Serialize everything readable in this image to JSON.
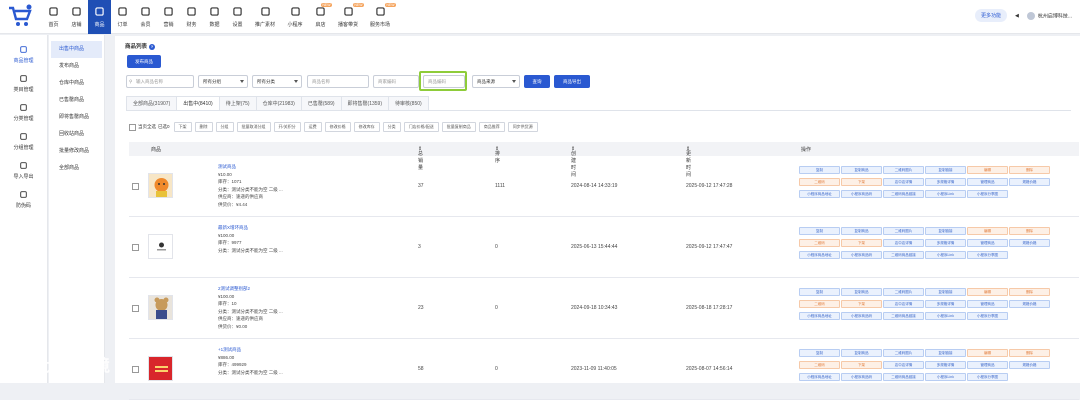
{
  "topnav": {
    "items": [
      {
        "label": "首页",
        "icon": "home-icon",
        "active": false,
        "badge": ""
      },
      {
        "label": "店铺",
        "icon": "shop-icon",
        "active": false,
        "badge": ""
      },
      {
        "label": "商品",
        "icon": "goods-icon",
        "active": true,
        "badge": ""
      },
      {
        "label": "订单",
        "icon": "order-icon",
        "active": false,
        "badge": ""
      },
      {
        "label": "会员",
        "icon": "member-icon",
        "active": false,
        "badge": ""
      },
      {
        "label": "营销",
        "icon": "marketing-icon",
        "active": false,
        "badge": ""
      },
      {
        "label": "财务",
        "icon": "finance-icon",
        "active": false,
        "badge": ""
      },
      {
        "label": "数据",
        "icon": "data-icon",
        "active": false,
        "badge": ""
      },
      {
        "label": "设置",
        "icon": "settings-icon",
        "active": false,
        "badge": ""
      },
      {
        "label": "推广素材",
        "icon": "share-icon",
        "active": false,
        "badge": ""
      },
      {
        "label": "小程序",
        "icon": "miniprogram-icon",
        "active": false,
        "badge": ""
      },
      {
        "label": "启店",
        "icon": "store-open-icon",
        "active": false,
        "badge": "NEW"
      },
      {
        "label": "播客带货",
        "icon": "live-icon",
        "active": false,
        "badge": "NEW"
      },
      {
        "label": "服务市场",
        "icon": "market-icon",
        "active": false,
        "badge": "NEW"
      }
    ],
    "more_features": "更多功能",
    "user": "杭州启博科技..."
  },
  "left_sidebar": [
    {
      "label": "商品管理",
      "icon": "goods-manage-icon",
      "active": true
    },
    {
      "label": "类目管理",
      "icon": "category-icon",
      "active": false
    },
    {
      "label": "分类管理",
      "icon": "classify-icon",
      "active": false
    },
    {
      "label": "分组管理",
      "icon": "group-icon",
      "active": false
    },
    {
      "label": "导入导出",
      "icon": "import-export-icon",
      "active": false
    },
    {
      "label": "防伪码",
      "icon": "anticounterfeit-icon",
      "active": false
    }
  ],
  "sub_sidebar": [
    {
      "label": "出售中商品",
      "active": true
    },
    {
      "label": "发布商品",
      "active": false
    },
    {
      "label": "仓库中商品",
      "active": false
    },
    {
      "label": "已售罄商品",
      "active": false
    },
    {
      "label": "即将售罄商品",
      "active": false
    },
    {
      "label": "回收站商品",
      "active": false
    },
    {
      "label": "批量修改商品",
      "active": false
    },
    {
      "label": "全部商品",
      "active": false
    }
  ],
  "page": {
    "title": "商品列表",
    "publish_button": "发布商品"
  },
  "filters": {
    "goods_name_placeholder": "输入商品名称",
    "group_select": "所有分组",
    "category_select": "所有分类",
    "name_placeholder": "商品名称",
    "merchant_code_placeholder": "商家编码",
    "goods_code_placeholder": "商品编码",
    "source_select": "商品来源",
    "search_button": "查询",
    "export_button": "商品导出"
  },
  "tabs": [
    {
      "label": "全部商品(31907)",
      "active": false
    },
    {
      "label": "出售中(8410)",
      "active": true
    },
    {
      "label": "待上架(75)",
      "active": false
    },
    {
      "label": "仓库中(21983)",
      "active": false
    },
    {
      "label": "已售罄(589)",
      "active": false
    },
    {
      "label": "即将售罄(1359)",
      "active": false
    },
    {
      "label": "待审核(850)",
      "active": false
    }
  ],
  "batch_actions": {
    "select_page": "当页全选",
    "selected": "已选0",
    "buttons": [
      "下架",
      "删除",
      "分组",
      "批量取消分组",
      "开/关积分",
      "运费",
      "修改价格",
      "修改库存",
      "分类",
      "门店价格/配送",
      "批量复制商品",
      "商品推荐",
      "同步供货源"
    ]
  },
  "table": {
    "headers": {
      "goods": "商品",
      "total_sales": "总销量",
      "sort": "排序",
      "created": "创建时间",
      "updated": "更新时间",
      "ops": "操作"
    },
    "rows": [
      {
        "name": "测试商品",
        "price": "¥10.00",
        "stock": "库存：1071",
        "category": "分类：测试分类不能为空 二级 ...",
        "supplier": "供应商：速递的供应商",
        "supply_price": "供货价：¥4.44",
        "total_sales": "37",
        "sort": "1111",
        "created": "2024-08-14 14:33:19",
        "updated": "2025-09-12 17:47:28",
        "thumb": "doll"
      },
      {
        "name": "最新X增环商品",
        "price": "¥100.00",
        "stock": "库存：9977",
        "category": "分类：测试分类不能为空 二级 ...",
        "supplier": "",
        "supply_price": "",
        "total_sales": "3",
        "sort": "0",
        "created": "2025-06-13 15:44:44",
        "updated": "2025-09-12 17:47:47",
        "thumb": "icon"
      },
      {
        "name": "2测试调整别部2",
        "price": "¥100.00",
        "stock": "库存：10",
        "category": "分类：测试分类不能为空 二级 ...",
        "supplier": "供应商：速递的供应商",
        "supply_price": "供货价：¥0.00",
        "total_sales": "23",
        "sort": "0",
        "created": "2024-09-18 10:34:43",
        "updated": "2025-08-18 17:28:17",
        "thumb": "toy"
      },
      {
        "name": "+1测试商品",
        "price": "¥886.00",
        "stock": "库存：499929",
        "category": "分类：测试分类不能为空 二级 ...",
        "supplier": "",
        "supply_price": "",
        "total_sales": "58",
        "sort": "0",
        "created": "2023-11-09 11:40:05",
        "updated": "2025-08-07 14:56:14",
        "thumb": "red"
      }
    ]
  },
  "ops": {
    "row1": [
      "复制",
      "复制商品",
      "二维码图片",
      "复制链接",
      "编辑",
      "删除"
    ],
    "row2": [
      "二维码",
      "下架",
      "店中店详情",
      "多规格详情",
      "管理商品",
      "规格价格"
    ],
    "row3": [
      "小程序商品地址",
      "小程序商品码",
      "二维码商品链接",
      "小程序Link",
      "小程序分享图"
    ],
    "row2_orange": [
      true,
      true,
      false,
      false,
      false,
      false
    ]
  },
  "watermark": "大数跨境",
  "colors": {
    "primary": "#2a59d1",
    "highlight": "#8ecc3a",
    "orange": "#f5a45d"
  }
}
